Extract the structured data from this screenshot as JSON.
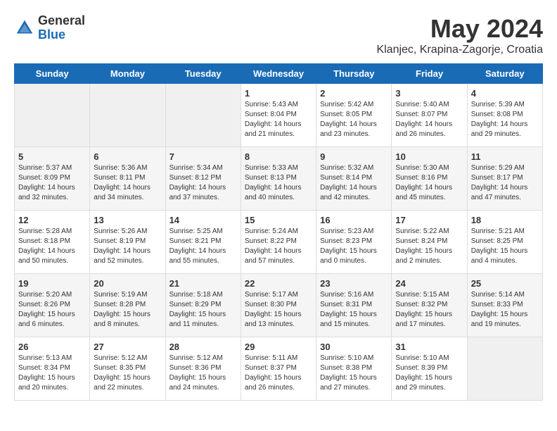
{
  "header": {
    "logo_general": "General",
    "logo_blue": "Blue",
    "main_title": "May 2024",
    "subtitle": "Klanjec, Krapina-Zagorje, Croatia"
  },
  "days_of_week": [
    "Sunday",
    "Monday",
    "Tuesday",
    "Wednesday",
    "Thursday",
    "Friday",
    "Saturday"
  ],
  "weeks": [
    {
      "days": [
        {
          "num": "",
          "empty": true
        },
        {
          "num": "",
          "empty": true
        },
        {
          "num": "",
          "empty": true
        },
        {
          "num": "1",
          "sunrise": "5:43 AM",
          "sunset": "8:04 PM",
          "daylight": "14 hours and 21 minutes."
        },
        {
          "num": "2",
          "sunrise": "5:42 AM",
          "sunset": "8:05 PM",
          "daylight": "14 hours and 23 minutes."
        },
        {
          "num": "3",
          "sunrise": "5:40 AM",
          "sunset": "8:07 PM",
          "daylight": "14 hours and 26 minutes."
        },
        {
          "num": "4",
          "sunrise": "5:39 AM",
          "sunset": "8:08 PM",
          "daylight": "14 hours and 29 minutes."
        }
      ]
    },
    {
      "days": [
        {
          "num": "5",
          "sunrise": "5:37 AM",
          "sunset": "8:09 PM",
          "daylight": "14 hours and 32 minutes."
        },
        {
          "num": "6",
          "sunrise": "5:36 AM",
          "sunset": "8:11 PM",
          "daylight": "14 hours and 34 minutes."
        },
        {
          "num": "7",
          "sunrise": "5:34 AM",
          "sunset": "8:12 PM",
          "daylight": "14 hours and 37 minutes."
        },
        {
          "num": "8",
          "sunrise": "5:33 AM",
          "sunset": "8:13 PM",
          "daylight": "14 hours and 40 minutes."
        },
        {
          "num": "9",
          "sunrise": "5:32 AM",
          "sunset": "8:14 PM",
          "daylight": "14 hours and 42 minutes."
        },
        {
          "num": "10",
          "sunrise": "5:30 AM",
          "sunset": "8:16 PM",
          "daylight": "14 hours and 45 minutes."
        },
        {
          "num": "11",
          "sunrise": "5:29 AM",
          "sunset": "8:17 PM",
          "daylight": "14 hours and 47 minutes."
        }
      ]
    },
    {
      "days": [
        {
          "num": "12",
          "sunrise": "5:28 AM",
          "sunset": "8:18 PM",
          "daylight": "14 hours and 50 minutes."
        },
        {
          "num": "13",
          "sunrise": "5:26 AM",
          "sunset": "8:19 PM",
          "daylight": "14 hours and 52 minutes."
        },
        {
          "num": "14",
          "sunrise": "5:25 AM",
          "sunset": "8:21 PM",
          "daylight": "14 hours and 55 minutes."
        },
        {
          "num": "15",
          "sunrise": "5:24 AM",
          "sunset": "8:22 PM",
          "daylight": "14 hours and 57 minutes."
        },
        {
          "num": "16",
          "sunrise": "5:23 AM",
          "sunset": "8:23 PM",
          "daylight": "15 hours and 0 minutes."
        },
        {
          "num": "17",
          "sunrise": "5:22 AM",
          "sunset": "8:24 PM",
          "daylight": "15 hours and 2 minutes."
        },
        {
          "num": "18",
          "sunrise": "5:21 AM",
          "sunset": "8:25 PM",
          "daylight": "15 hours and 4 minutes."
        }
      ]
    },
    {
      "days": [
        {
          "num": "19",
          "sunrise": "5:20 AM",
          "sunset": "8:26 PM",
          "daylight": "15 hours and 6 minutes."
        },
        {
          "num": "20",
          "sunrise": "5:19 AM",
          "sunset": "8:28 PM",
          "daylight": "15 hours and 8 minutes."
        },
        {
          "num": "21",
          "sunrise": "5:18 AM",
          "sunset": "8:29 PM",
          "daylight": "15 hours and 11 minutes."
        },
        {
          "num": "22",
          "sunrise": "5:17 AM",
          "sunset": "8:30 PM",
          "daylight": "15 hours and 13 minutes."
        },
        {
          "num": "23",
          "sunrise": "5:16 AM",
          "sunset": "8:31 PM",
          "daylight": "15 hours and 15 minutes."
        },
        {
          "num": "24",
          "sunrise": "5:15 AM",
          "sunset": "8:32 PM",
          "daylight": "15 hours and 17 minutes."
        },
        {
          "num": "25",
          "sunrise": "5:14 AM",
          "sunset": "8:33 PM",
          "daylight": "15 hours and 19 minutes."
        }
      ]
    },
    {
      "days": [
        {
          "num": "26",
          "sunrise": "5:13 AM",
          "sunset": "8:34 PM",
          "daylight": "15 hours and 20 minutes."
        },
        {
          "num": "27",
          "sunrise": "5:12 AM",
          "sunset": "8:35 PM",
          "daylight": "15 hours and 22 minutes."
        },
        {
          "num": "28",
          "sunrise": "5:12 AM",
          "sunset": "8:36 PM",
          "daylight": "15 hours and 24 minutes."
        },
        {
          "num": "29",
          "sunrise": "5:11 AM",
          "sunset": "8:37 PM",
          "daylight": "15 hours and 26 minutes."
        },
        {
          "num": "30",
          "sunrise": "5:10 AM",
          "sunset": "8:38 PM",
          "daylight": "15 hours and 27 minutes."
        },
        {
          "num": "31",
          "sunrise": "5:10 AM",
          "sunset": "8:39 PM",
          "daylight": "15 hours and 29 minutes."
        },
        {
          "num": "",
          "empty": true
        }
      ]
    }
  ]
}
